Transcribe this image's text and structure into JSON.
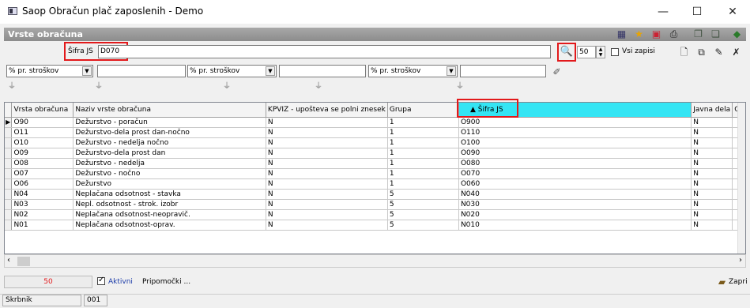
{
  "window": {
    "title": "Saop Obračun plač zaposlenih - Demo",
    "minimize": "—",
    "maximize": "☐",
    "close": "✕"
  },
  "form": {
    "title": "Vrste obračuna"
  },
  "toolbar_icons": [
    "grid-icon",
    "star-icon",
    "export-icon",
    "print-icon",
    "copy-icon",
    "paste-icon",
    "exit-icon"
  ],
  "search": {
    "label": "Šifra JS",
    "value": "D070",
    "count": "50",
    "show_all_label": "Vsi zapisi",
    "show_all_checked": false
  },
  "filters": [
    {
      "field": "% pr. stroškov",
      "value": ""
    },
    {
      "field": "% pr. stroškov",
      "value": ""
    },
    {
      "field": "% pr. stroškov",
      "value": ""
    }
  ],
  "table": {
    "columns": [
      "Vrsta obračuna",
      "Naziv vrste obračuna",
      "KPVIZ - upošteva se polni znesek",
      "Grupa",
      "Šifra JS",
      "Javna dela",
      "Gr"
    ],
    "sorted_column": "Šifra JS",
    "rows": [
      [
        "O90",
        "Dežurstvo - poračun",
        "N",
        "1",
        "O900",
        "N",
        ""
      ],
      [
        "O11",
        "Dežurstvo-dela prost dan-nočno",
        "N",
        "1",
        "O110",
        "N",
        ""
      ],
      [
        "O10",
        "Dežurstvo - nedelja nočno",
        "N",
        "1",
        "O100",
        "N",
        ""
      ],
      [
        "O09",
        "Dežurstvo-dela prost dan",
        "N",
        "1",
        "O090",
        "N",
        ""
      ],
      [
        "O08",
        "Dežurstvo - nedelja",
        "N",
        "1",
        "O080",
        "N",
        ""
      ],
      [
        "O07",
        "Dežurstvo - nočno",
        "N",
        "1",
        "O070",
        "N",
        ""
      ],
      [
        "O06",
        "Dežurstvo",
        "N",
        "1",
        "O060",
        "N",
        ""
      ],
      [
        "N04",
        "Neplačana odsotnost - stavka",
        "N",
        "5",
        "N040",
        "N",
        ""
      ],
      [
        "N03",
        "Nepl. odsotnost - strok. izobr",
        "N",
        "5",
        "N030",
        "N",
        ""
      ],
      [
        "N02",
        "Neplačana odsotnost-neopravič.",
        "N",
        "5",
        "N020",
        "N",
        ""
      ],
      [
        "N01",
        "Neplačana odsotnost-oprav.",
        "N",
        "5",
        "N010",
        "N",
        ""
      ]
    ]
  },
  "bottom": {
    "record_count": "50",
    "active_label": "Aktivni",
    "active_checked": true,
    "tools_label": "Pripomočki ...",
    "close_label": "Zapri"
  },
  "status": {
    "user": "Skrbnik",
    "code": "001"
  },
  "colors": {
    "sorted_header": "#34e5f4",
    "highlight_box": "#e2191b",
    "form_header": "#999999"
  }
}
